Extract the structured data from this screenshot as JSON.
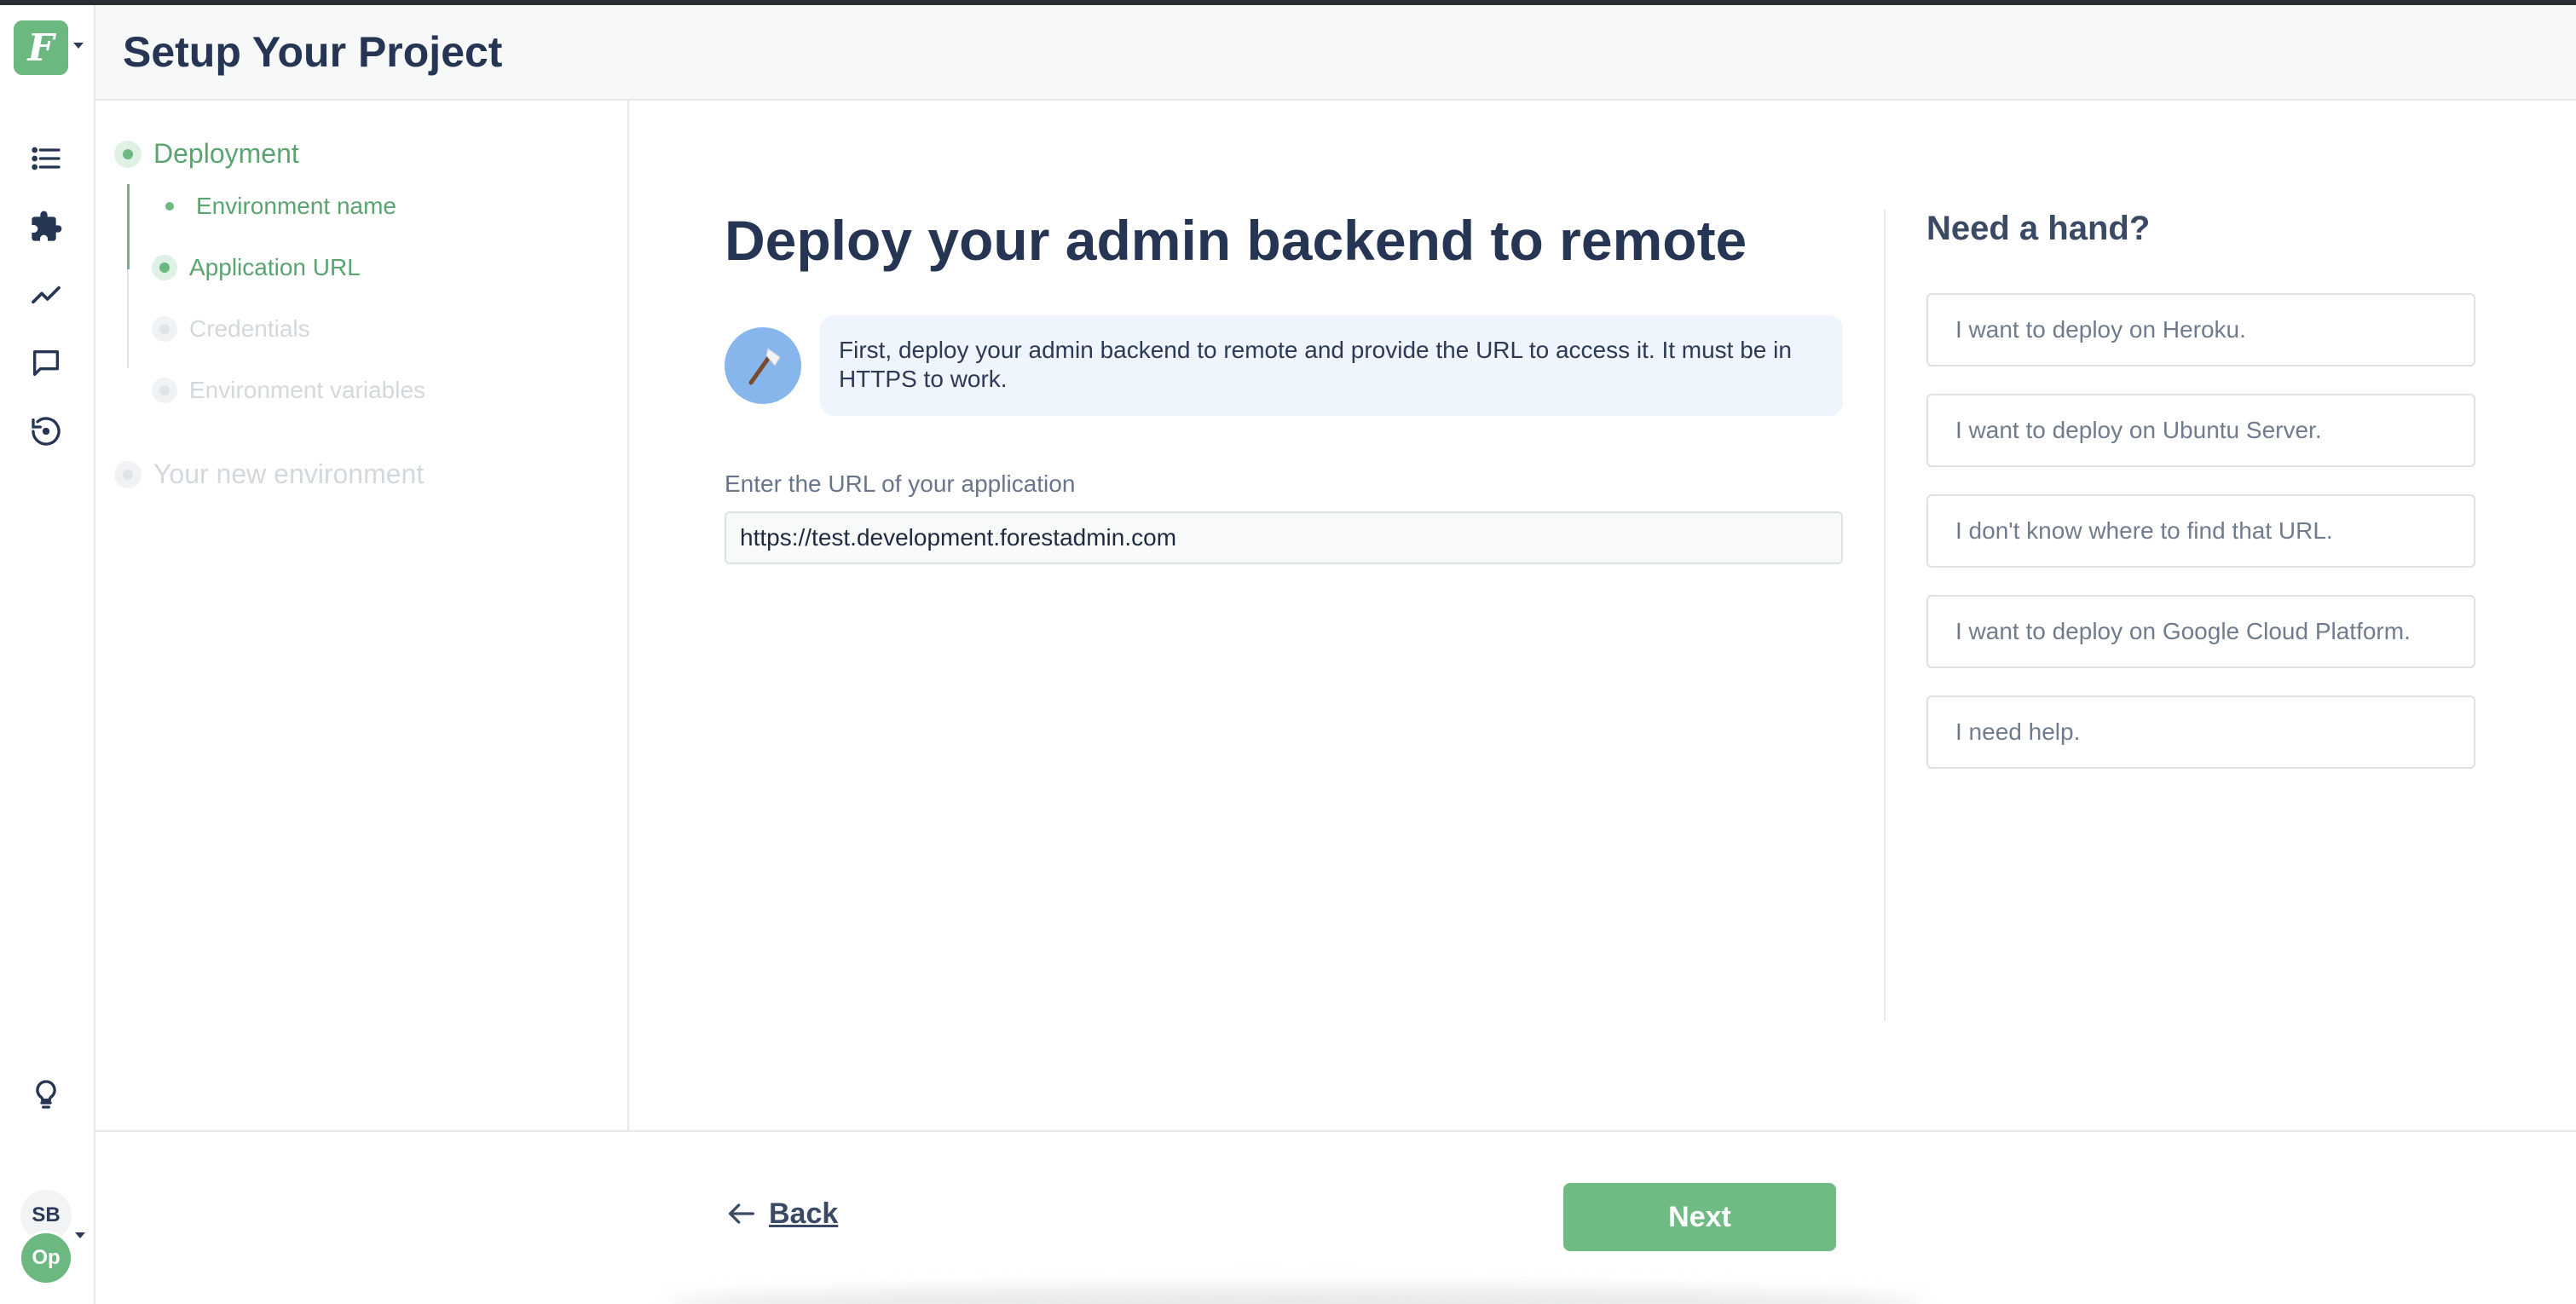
{
  "header": {
    "title": "Setup Your Project"
  },
  "logo": {
    "letter": "F"
  },
  "rail": {
    "avatar_primary": "SB",
    "avatar_secondary": "Op"
  },
  "steps": {
    "deployment": "Deployment",
    "environment_name": "Environment name",
    "application_url": "Application URL",
    "credentials": "Credentials",
    "environment_variables": "Environment variables",
    "new_environment": "Your new environment"
  },
  "main": {
    "title": "Deploy your admin backend to remote",
    "hint": "First, deploy your admin backend to remote and provide the URL to access it. It must be in HTTPS to work.",
    "url_label": "Enter the URL of your application",
    "url_value": "https://test.development.forestadmin.com"
  },
  "help": {
    "title": "Need a hand?",
    "options": [
      "I want to deploy on Heroku.",
      "I want to deploy on Ubuntu Server.",
      "I don't know where to find that URL.",
      "I want to deploy on Google Cloud Platform.",
      "I need help."
    ]
  },
  "footer": {
    "back_label": "Back",
    "next_label": "Next"
  },
  "colors": {
    "accent": "#6bb980",
    "title": "#263553",
    "muted": "#c9d0d6",
    "hint_bg": "#eef5fd"
  }
}
